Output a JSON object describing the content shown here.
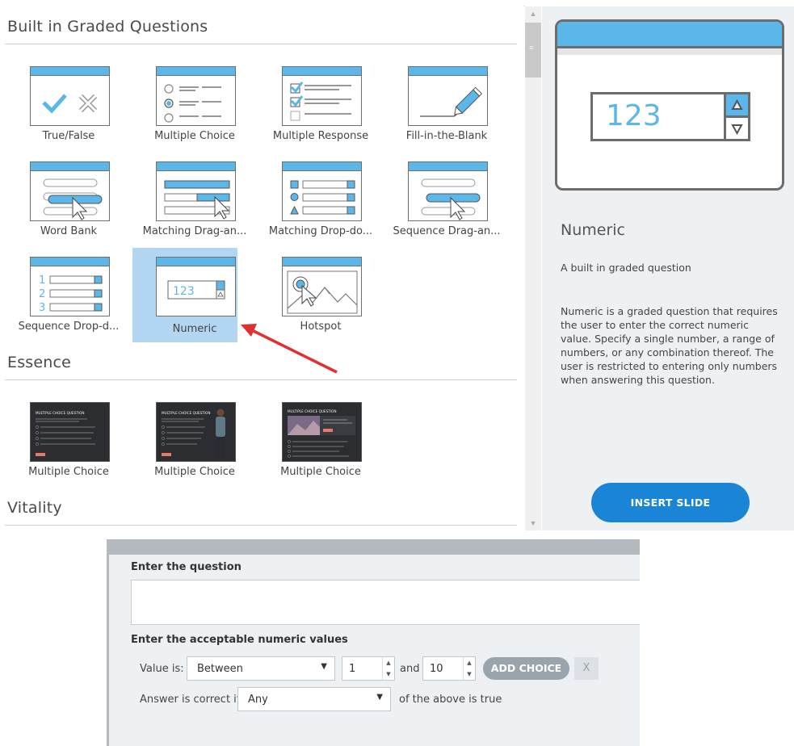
{
  "sections": [
    {
      "title": "Built in Graded Questions"
    },
    {
      "title": "Essence"
    },
    {
      "title": "Vitality"
    }
  ],
  "graded_questions": [
    {
      "label": "True/False",
      "icon": "true-false-thumbnail-icon"
    },
    {
      "label": "Multiple Choice",
      "icon": "multiple-choice-thumbnail-icon"
    },
    {
      "label": "Multiple Response",
      "icon": "multiple-response-thumbnail-icon"
    },
    {
      "label": "Fill-in-the-Blank",
      "icon": "fill-in-the-blank-thumbnail-icon"
    },
    {
      "label": "Word Bank",
      "icon": "word-bank-thumbnail-icon"
    },
    {
      "label": "Matching  Drag-an...",
      "icon": "matching-drag-thumbnail-icon"
    },
    {
      "label": "Matching  Drop-do...",
      "icon": "matching-dropdown-thumbnail-icon"
    },
    {
      "label": "Sequence  Drag-an...",
      "icon": "sequence-drag-thumbnail-icon"
    },
    {
      "label": "Sequence  Drop-d...",
      "icon": "sequence-dropdown-thumbnail-icon"
    },
    {
      "label": "Numeric",
      "icon": "numeric-thumbnail-icon",
      "selected": true,
      "thumb_text": "123"
    },
    {
      "label": "Hotspot",
      "icon": "hotspot-thumbnail-icon"
    }
  ],
  "essence_items": [
    {
      "label": "Multiple Choice",
      "thumb_title": "MULTIPLE CHOICE QUESTION"
    },
    {
      "label": "Multiple Choice",
      "thumb_title": "MULTIPLE CHOICE QUESTION"
    },
    {
      "label": "Multiple Choice",
      "thumb_title": "MULTIPLE CHOICE QUESTION"
    }
  ],
  "details": {
    "preview_number": "123",
    "title": "Numeric",
    "subtitle": "A built in graded question",
    "description": "Numeric is a graded question that requires the user to enter the correct numeric value. Specify a single number, a range of numbers, or any combination thereof. The user is restricted to entering only numbers when answering this question.",
    "insert_button": "INSERT SLIDE"
  },
  "scrollbar": {
    "up": "▲",
    "down": "▼",
    "grip": "≡"
  },
  "form": {
    "question_heading": "Enter the question",
    "question_value": "",
    "values_heading": "Enter the acceptable numeric values",
    "value_is_label": "Value is:",
    "value_is_selected": "Between",
    "min_value": "1",
    "and_label": "and",
    "max_value": "10",
    "add_choice": "ADD CHOICE",
    "remove": "X",
    "correct_if_label": "Answer is correct if",
    "correct_if_selected": "Any",
    "correct_if_suffix": "of the above is true"
  },
  "colors": {
    "accent": "#5bb7ea",
    "insert_button": "#1a85d6",
    "selected_tile": "#b3d6f2",
    "annotation_arrow": "#e03030"
  }
}
